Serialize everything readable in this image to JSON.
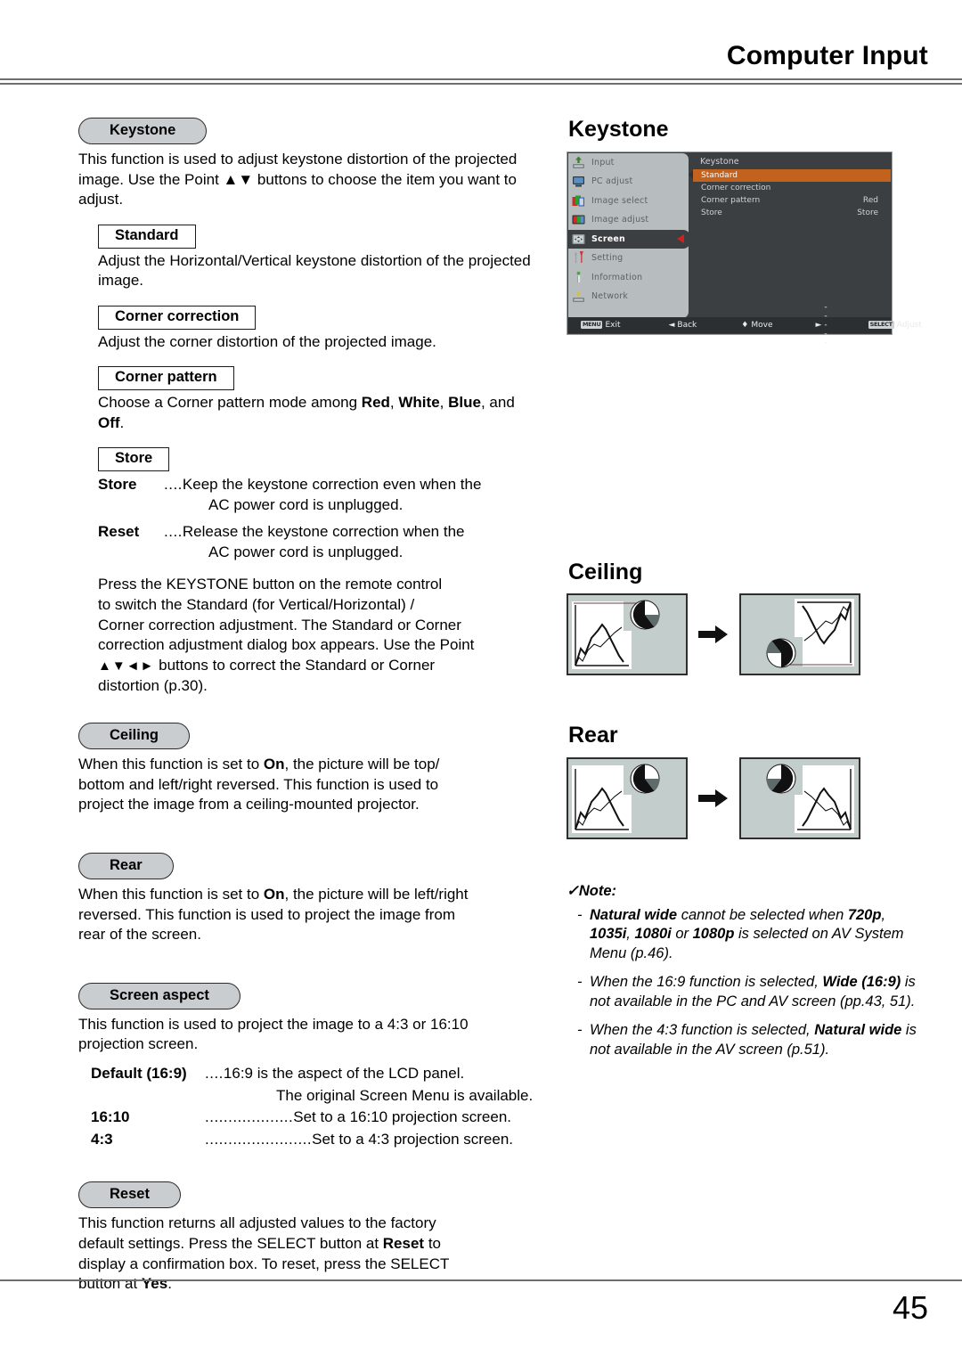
{
  "header": {
    "title": "Computer Input"
  },
  "footer": {
    "page_number": "45"
  },
  "left": {
    "keystone": {
      "pill": "Keystone",
      "intro": "This function is used to adjust keystone distortion of the projected image. Use the Point ▲▼ buttons to choose the item you want to adjust.",
      "standard": {
        "label": "Standard",
        "text": "Adjust the Horizontal/Vertical keystone distortion of the projected image."
      },
      "corner_correction": {
        "label": "Corner correction",
        "text": "Adjust the corner distortion of the projected image."
      },
      "corner_pattern": {
        "label": "Corner pattern",
        "text_a": "Choose a Corner pattern mode among ",
        "opt1": "Red",
        "sep1": ", ",
        "opt2": "White",
        "sep2": ", ",
        "opt3": "Blue",
        "sep3": ",",
        "text_b": "and ",
        "opt4": "Off",
        "text_c": "."
      },
      "store": {
        "label": "Store",
        "rows": [
          {
            "term": "Store",
            "leader": "....",
            "desc": "Keep the keystone correction even when the",
            "cont": "AC power cord is unplugged."
          },
          {
            "term": "Reset",
            "leader": "....",
            "desc": "Release the keystone correction when the",
            "cont": "AC power cord is unplugged."
          }
        ]
      },
      "keystone_button_note": "Press the KEYSTONE button on the remote control\nto switch the Standard (for Vertical/Horizontal) /\nCorner correction adjustment. The Standard or Corner\ncorrection adjustment dialog box appears. Use the Point",
      "keystone_button_note2_glyphs": "▲▼◄►",
      "keystone_button_note2": " buttons to correct the Standard or Corner\ndistortion (p.30)."
    },
    "ceiling": {
      "pill": "Ceiling",
      "text_a": "When this function is set to ",
      "on": "On",
      "text_b": ", the picture will be top/\nbottom and left/right reversed. This function is used to\nproject the image from a ceiling-mounted projector."
    },
    "rear": {
      "pill": "Rear",
      "text_a": "When this function is set to ",
      "on": "On",
      "text_b": ", the picture will be left/right\nreversed. This function is used to project the image from\nrear of the screen."
    },
    "screen_aspect": {
      "pill": "Screen aspect",
      "intro": "This function is used to project the image to a 4:3 or 16:10\nprojection screen.",
      "rows": [
        {
          "term": "Default (16:9)",
          "leader": "....",
          "desc": "16:9 is the aspect of the LCD panel.",
          "cont": "The original Screen Menu is available."
        },
        {
          "term": "16:10",
          "leader": "...................",
          "desc": "Set to a 16:10 projection screen.",
          "cont": ""
        },
        {
          "term": "4:3",
          "leader": ".......................",
          "desc": "Set to a 4:3 projection screen.",
          "cont": ""
        }
      ]
    },
    "reset": {
      "pill": "Reset",
      "text_a": "This function returns all adjusted values to the factory\ndefault settings. Press the SELECT button at ",
      "b1": "Reset",
      "text_b": " to\ndisplay a confirmation box. To reset, press the SELECT\nbutton at ",
      "b2": "Yes",
      "text_c": "."
    }
  },
  "right": {
    "keystone_heading": "Keystone",
    "osd": {
      "sidebar": [
        {
          "label": "Input",
          "icon": "input-icon",
          "active": false
        },
        {
          "label": "PC adjust",
          "icon": "pc-adjust-icon",
          "active": false
        },
        {
          "label": "Image select",
          "icon": "image-select-icon",
          "active": false
        },
        {
          "label": "Image adjust",
          "icon": "image-adjust-icon",
          "active": false
        },
        {
          "label": "Screen",
          "icon": "screen-icon",
          "active": true
        },
        {
          "label": "Setting",
          "icon": "setting-icon",
          "active": false
        },
        {
          "label": "Information",
          "icon": "information-icon",
          "active": false
        },
        {
          "label": "Network",
          "icon": "network-icon",
          "active": false
        }
      ],
      "panel_title": "Keystone",
      "rows": [
        {
          "label": "Standard",
          "value": "",
          "selected": true
        },
        {
          "label": "Corner correction",
          "value": "",
          "selected": false
        },
        {
          "label": "Corner pattern",
          "value": "Red",
          "selected": false
        },
        {
          "label": "Store",
          "value": "Store",
          "selected": false
        }
      ],
      "statusbar": [
        {
          "key": "MENU",
          "glyph": "",
          "label": "Exit"
        },
        {
          "key": "",
          "glyph": "◄",
          "label": "Back"
        },
        {
          "key": "",
          "glyph": "♦",
          "label": "Move"
        },
        {
          "key": "",
          "glyph": "►",
          "label": "-----"
        },
        {
          "key": "SELECT",
          "glyph": "",
          "label": "Adjust"
        }
      ],
      "colors": {
        "highlight": "#c2621c",
        "panel_bg": "#3b3f42",
        "sidebar_bg": "#b7bcbe",
        "caret": "#d12020"
      }
    },
    "ceiling_heading": "Ceiling",
    "rear_heading": "Rear",
    "note": {
      "title": "Note:",
      "check": "✓",
      "items": [
        {
          "dash": "-",
          "parts": [
            {
              "t": "Natural wide",
              "b": true
            },
            {
              "t": " cannot be selected when ",
              "b": false
            },
            {
              "t": "720p",
              "b": true
            },
            {
              "t": ", ",
              "b": false
            },
            {
              "t": "1035i",
              "b": true
            },
            {
              "t": ", ",
              "b": false
            },
            {
              "t": "1080i",
              "b": true
            },
            {
              "t": " or ",
              "b": false
            },
            {
              "t": "1080p",
              "b": true
            },
            {
              "t": " is selected on AV System Menu (p.46).",
              "b": false
            }
          ]
        },
        {
          "dash": "-",
          "parts": [
            {
              "t": "When the 16:9 function is selected, ",
              "b": false
            },
            {
              "t": "Wide (16:9)",
              "b": true
            },
            {
              "t": " is not available in the PC and AV screen (pp.43, 51).",
              "b": false
            }
          ]
        },
        {
          "dash": "-",
          "parts": [
            {
              "t": "When the 4:3 function is selected, ",
              "b": false
            },
            {
              "t": "Natural wide",
              "b": true
            },
            {
              "t": " is not available in the AV screen (p.51).",
              "b": false
            }
          ]
        }
      ]
    }
  }
}
